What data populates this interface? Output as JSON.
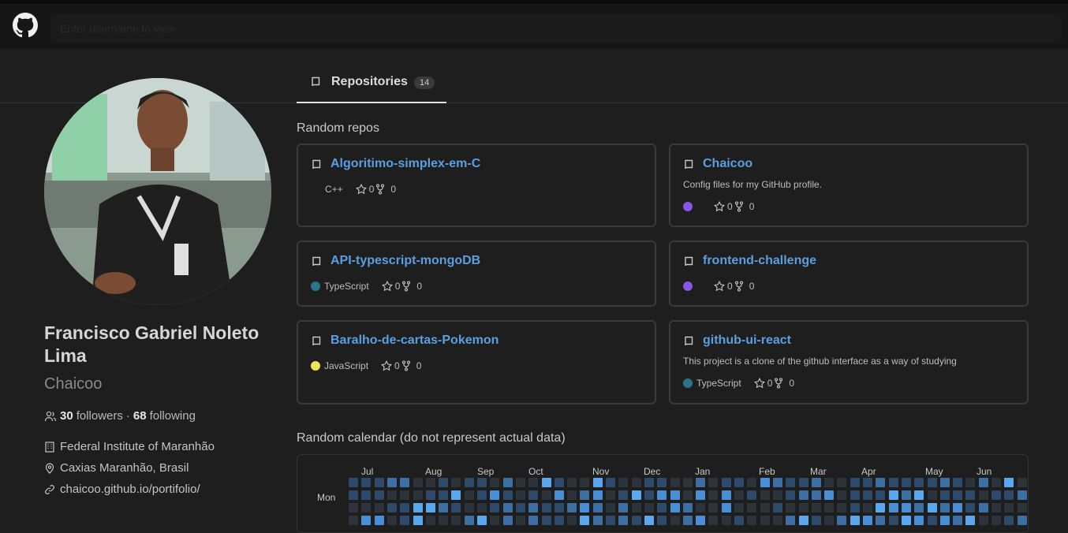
{
  "header": {
    "search_placeholder": "Enter username to view"
  },
  "tabs": [
    {
      "label": "Repositories",
      "count": "14"
    }
  ],
  "profile": {
    "name": "Francisco Gabriel Noleto Lima",
    "login": "Chaicoo",
    "followers": "30",
    "followers_label": "followers",
    "separator": "·",
    "following": "68",
    "following_label": "following",
    "company": "Federal Institute of Maranhão",
    "location": "Caxias Maranhão, Brasil",
    "website": "chaicoo.github.io/portifolio/"
  },
  "repos": {
    "title": "Random repos",
    "items": [
      {
        "name": "Algoritimo-simplex-em-C",
        "description": "",
        "language": "C++",
        "language_color": "",
        "stars": "0",
        "forks": "0"
      },
      {
        "name": "Chaicoo",
        "description": "Config files for my GitHub profile.",
        "language": "",
        "language_color": "#8957e5",
        "stars": "0",
        "forks": "0"
      },
      {
        "name": "API-typescript-mongoDB",
        "description": "",
        "language": "TypeScript",
        "language_color": "#2b7489",
        "stars": "0",
        "forks": "0"
      },
      {
        "name": "frontend-challenge",
        "description": "",
        "language": "",
        "language_color": "#8957e5",
        "stars": "0",
        "forks": "0"
      },
      {
        "name": "Baralho-de-cartas-Pokemon",
        "description": "",
        "language": "JavaScript",
        "language_color": "#f1e05a",
        "stars": "0",
        "forks": "0"
      },
      {
        "name": "github-ui-react",
        "description": "This project is a clone of the github interface as a way of studying",
        "language": "TypeScript",
        "language_color": "#2b7489",
        "stars": "0",
        "forks": "0"
      }
    ]
  },
  "calendar": {
    "title": "Random calendar (do not represent actual data)",
    "months": [
      "Jul",
      "Aug",
      "Sep",
      "Oct",
      "Nov",
      "Dec",
      "Jan",
      "Feb",
      "Mar",
      "Apr",
      "May",
      "Jun"
    ],
    "day_label": "Mon",
    "colors": [
      "#2d333b",
      "#2d4a6b",
      "#3e6fa3",
      "#4a8fd6",
      "#5ba8ee"
    ]
  },
  "icons": [
    "github-logo-icon",
    "repo-icon",
    "star-icon",
    "fork-icon",
    "people-icon",
    "building-icon",
    "location-icon",
    "link-icon"
  ]
}
